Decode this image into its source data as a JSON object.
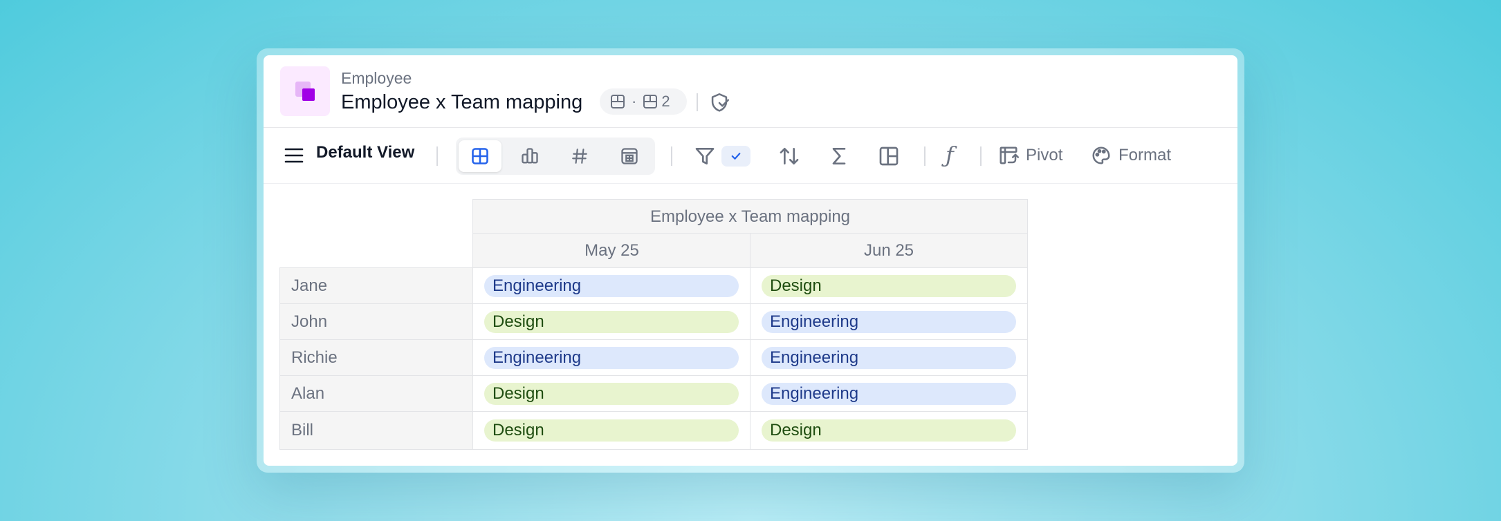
{
  "header": {
    "breadcrumb": "Employee",
    "title": "Employee x Team mapping",
    "meta_separator": "·",
    "meta_count": "2"
  },
  "toolbar": {
    "view_name": "Default View",
    "pivot_label": "Pivot",
    "format_label": "Format",
    "formula_glyph": "ƒ",
    "active_view_type": "table",
    "filter_applied": true
  },
  "table": {
    "group_header": "Employee x Team mapping",
    "columns": [
      "May 25",
      "Jun 25"
    ],
    "rows": [
      {
        "name": "Jane",
        "values": [
          "Engineering",
          "Design"
        ]
      },
      {
        "name": "John",
        "values": [
          "Design",
          "Engineering"
        ]
      },
      {
        "name": "Richie",
        "values": [
          "Engineering",
          "Engineering"
        ]
      },
      {
        "name": "Alan",
        "values": [
          "Design",
          "Engineering"
        ]
      },
      {
        "name": "Bill",
        "values": [
          "Design",
          "Design"
        ]
      }
    ]
  },
  "colors": {
    "accent": "#2563eb",
    "brand": "#a100e6",
    "engineering_bg": "#dde8fc",
    "design_bg": "#e8f4cf"
  }
}
